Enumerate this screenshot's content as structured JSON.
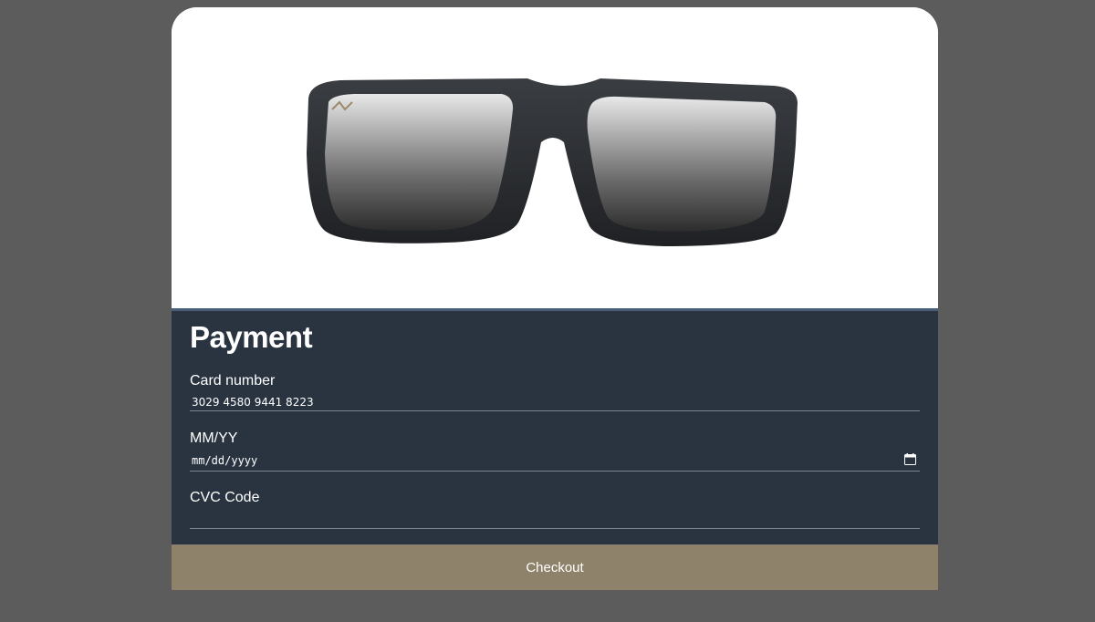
{
  "product": {
    "image_subject": "black rectangular sunglasses with grey lenses"
  },
  "payment": {
    "title": "Payment",
    "card_number": {
      "label": "Card number",
      "value": "3029 4580 9441 8223"
    },
    "expiry": {
      "label": "MM/YY",
      "placeholder": "mm/dd/yyyy"
    },
    "cvc": {
      "label": "CVC Code",
      "value": ""
    }
  },
  "checkout": {
    "label": "Checkout"
  },
  "colors": {
    "page_background": "#5c5c5c",
    "panel_background": "#2a3440",
    "panel_border": "#4a5d78",
    "button_background": "#8f826a"
  }
}
